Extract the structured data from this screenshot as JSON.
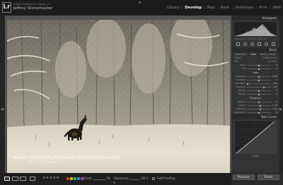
{
  "app": {
    "logo": "Lr",
    "catalog_line": "Adobe Lightroom Classic CC",
    "user_name": "Jeffrey Stonemaster"
  },
  "modules": [
    "Library",
    "Develop",
    "Map",
    "Book",
    "Slideshow",
    "Print",
    "Web"
  ],
  "active_module": "Develop",
  "photo": {
    "watermark_url": "www.yarnridgebreedcollections.com",
    "watermark_name": "Jeffrey Stonemaster"
  },
  "right_panel": {
    "histogram_title": "Histogram",
    "histogram_info": "ISO 400    65 mm    f/5.6    1/250 sec",
    "basic_title": "Basic",
    "treatment_tabs": [
      "Treatment",
      "Color",
      "Black & White"
    ],
    "profile_label": "Profile",
    "profile_value": "Adobe Color",
    "wb_label": "WB",
    "wb_value": "As Shot",
    "sliders": [
      {
        "label": "Temp",
        "value": "0",
        "pos": 0.5
      },
      {
        "label": "Tint",
        "value": "0",
        "pos": 0.5
      },
      {
        "label": "Tone",
        "value": "Auto",
        "pos": null
      },
      {
        "label": "Exposure",
        "value": "0.00",
        "pos": 0.5
      },
      {
        "label": "Contrast",
        "value": "0",
        "pos": 0.5
      },
      {
        "label": "Highlights",
        "value": "-100",
        "pos": 0.05
      },
      {
        "label": "Shadows",
        "value": "+47",
        "pos": 0.73
      },
      {
        "label": "Whites",
        "value": "0",
        "pos": 0.5
      },
      {
        "label": "Blacks",
        "value": "0",
        "pos": 0.5
      },
      {
        "label": "Presence",
        "value": "",
        "pos": null
      },
      {
        "label": "Texture",
        "value": "0",
        "pos": 0.5
      },
      {
        "label": "Clarity",
        "value": "+ 15",
        "pos": 0.58
      },
      {
        "label": "Vibrance",
        "value": "+ 15",
        "pos": 0.58
      },
      {
        "label": "Saturation",
        "value": "0",
        "pos": 0.5
      }
    ],
    "tone_curve_title": "Tone Curve",
    "tone_curve_footer": "Region",
    "previous_label": "Previous",
    "reset_label": "Reset"
  },
  "bottom_toolbar": {
    "stars": "★★★★★",
    "flag_colors": [
      "#c0392b",
      "#d4ac0d",
      "#27ae60",
      "#2e86c1",
      "#8e44ad"
    ],
    "zoom_label": "Zoom",
    "zoom_value": "Fit",
    "sharpness_label": "Sharpness",
    "sharpness_value": "Fill 1",
    "soft_proofing_label": "Soft Proofing"
  }
}
